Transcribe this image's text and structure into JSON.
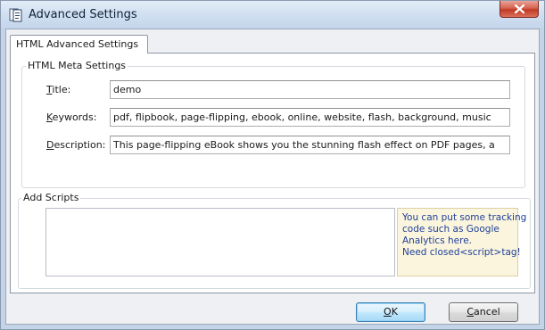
{
  "window": {
    "title": "Advanced Settings"
  },
  "tabs": [
    {
      "label": "HTML Advanced Settings",
      "selected": true
    }
  ],
  "meta_settings": {
    "group_title": "HTML Meta Settings",
    "title": {
      "accel": "T",
      "label_rest": "itle:",
      "value": "demo"
    },
    "keywords": {
      "accel": "K",
      "label_rest": "eywords:",
      "value": "pdf, flipbook, page-flipping, ebook, online, website, flash, background, music"
    },
    "description": {
      "accel": "D",
      "label_rest": "escription:",
      "value": "This page-flipping eBook shows you the stunning flash effect on PDF pages, a"
    }
  },
  "scripts": {
    "group_title": "Add Scripts",
    "value": "",
    "hint_lines": [
      "You can put some tracking",
      "code such as Google",
      "Analytics here.",
      "Need closed<script>tag!"
    ]
  },
  "buttons": {
    "ok": {
      "accel": "O",
      "label_rest": "K"
    },
    "cancel": {
      "accel": "C",
      "label_rest": "ancel"
    }
  },
  "icons": {
    "app": "app-icon",
    "close": "close-icon"
  },
  "colors": {
    "hint_text": "#1f3f9c",
    "hint_background": "#faf5dc",
    "close_button": "#c33a26"
  }
}
